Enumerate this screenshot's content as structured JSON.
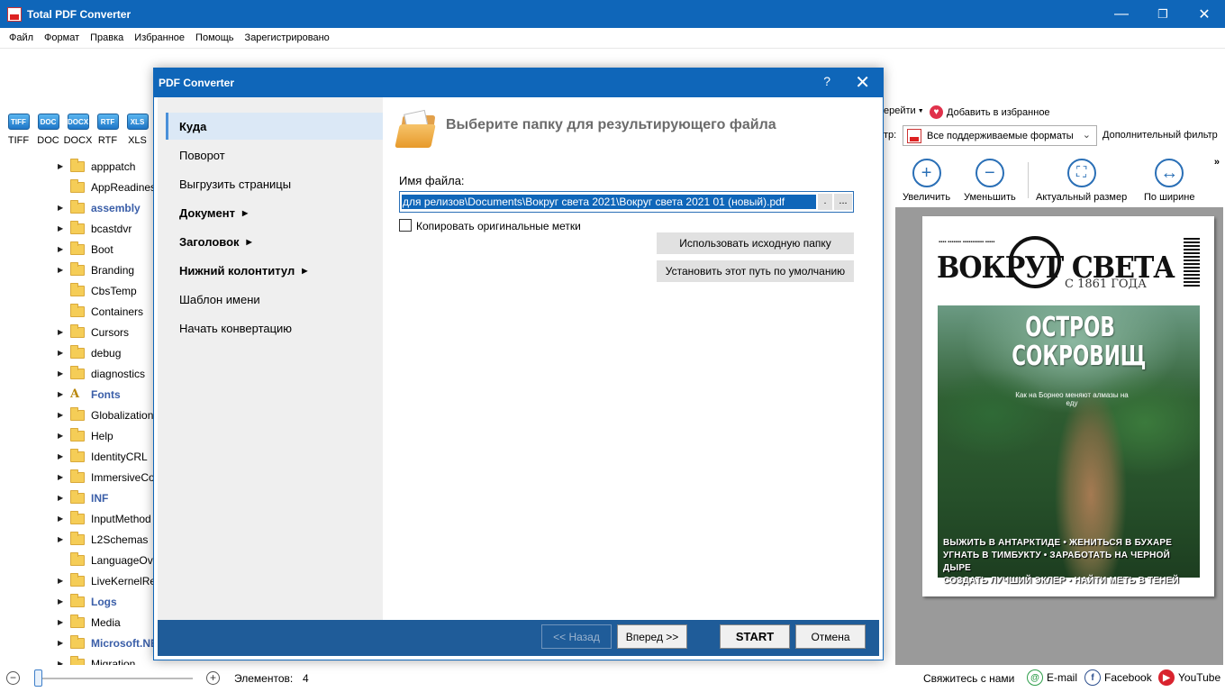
{
  "app": {
    "title": "Total PDF Converter"
  },
  "menu": [
    "Файл",
    "Формат",
    "Правка",
    "Избранное",
    "Помощь",
    "Зарегистрировано"
  ],
  "formats": [
    {
      "icon": "TIFF",
      "label": "TIFF"
    },
    {
      "icon": "DOC",
      "label": "DOC"
    },
    {
      "icon": "DOCX",
      "label": "DOCX"
    },
    {
      "icon": "RTF",
      "label": "RTF"
    },
    {
      "icon": "XLS",
      "label": "XLS"
    }
  ],
  "tree": [
    {
      "label": "apppatch",
      "arrow": true,
      "bold": false
    },
    {
      "label": "AppReadiness",
      "arrow": false,
      "bold": false
    },
    {
      "label": "assembly",
      "arrow": true,
      "bold": true
    },
    {
      "label": "bcastdvr",
      "arrow": true,
      "bold": false
    },
    {
      "label": "Boot",
      "arrow": true,
      "bold": false
    },
    {
      "label": "Branding",
      "arrow": true,
      "bold": false
    },
    {
      "label": "CbsTemp",
      "arrow": false,
      "bold": false
    },
    {
      "label": "Containers",
      "arrow": false,
      "bold": false
    },
    {
      "label": "Cursors",
      "arrow": true,
      "bold": false
    },
    {
      "label": "debug",
      "arrow": true,
      "bold": false
    },
    {
      "label": "diagnostics",
      "arrow": true,
      "bold": false
    },
    {
      "label": "Fonts",
      "arrow": true,
      "bold": true,
      "font_icon": true
    },
    {
      "label": "Globalization",
      "arrow": true,
      "bold": false
    },
    {
      "label": "Help",
      "arrow": true,
      "bold": false
    },
    {
      "label": "IdentityCRL",
      "arrow": true,
      "bold": false
    },
    {
      "label": "ImmersiveControlPanel",
      "arrow": true,
      "bold": false
    },
    {
      "label": "INF",
      "arrow": true,
      "bold": true
    },
    {
      "label": "InputMethod",
      "arrow": true,
      "bold": false
    },
    {
      "label": "L2Schemas",
      "arrow": true,
      "bold": false
    },
    {
      "label": "LanguageOverlayCache",
      "arrow": false,
      "bold": false
    },
    {
      "label": "LiveKernelReports",
      "arrow": true,
      "bold": false
    },
    {
      "label": "Logs",
      "arrow": true,
      "bold": true
    },
    {
      "label": "Media",
      "arrow": true,
      "bold": false
    },
    {
      "label": "Microsoft.NET",
      "arrow": true,
      "bold": true
    },
    {
      "label": "Migration",
      "arrow": true,
      "bold": false
    }
  ],
  "right_panel": {
    "goto_label": "ерейти",
    "favorite_label": "Добавить в избранное",
    "filter_label": "тр:",
    "filter_value": "Все поддерживаемые форматы",
    "extra_filter": "Дополнительный фильтр",
    "tools": [
      {
        "icon": "zoom-in",
        "glyph": "+",
        "label": "Увеличить"
      },
      {
        "icon": "zoom-out",
        "glyph": "−",
        "label": "Уменьшить"
      },
      {
        "icon": "actual-size",
        "glyph": "⛶",
        "label": "Актуальный размер"
      },
      {
        "icon": "fit-width",
        "glyph": "↔",
        "label": "По ширине"
      }
    ],
    "more": "»"
  },
  "magazine": {
    "title": "ВОКРУГ СВЕТА",
    "since": "С 1861 ГОДА",
    "headline": "ОСТРОВ СОКРОВИЩ",
    "subline": "Как на Борнео меняют алмазы на еду",
    "foot_lines": [
      "ВЫЖИТЬ В АНТАРКТИДЕ • ЖЕНИТЬСЯ В БУХАРЕ",
      "УГНАТЬ В ТИМБУКТУ • ЗАРАБОТАТЬ НА ЧЕРНОЙ ДЫРЕ",
      "СОЗДАТЬ ЛУЧШИЙ ЭКЛЕР • НАЙТИ МЕТЬ В ТЕНЕЙ"
    ]
  },
  "status": {
    "items_label": "Элементов:",
    "items_count": "4",
    "contact": "Свяжитесь с нами",
    "email": "E-mail",
    "facebook": "Facebook",
    "youtube": "YouTube"
  },
  "dialog": {
    "title": "PDF Converter",
    "help": "?",
    "close": "✕",
    "nav": [
      {
        "label": "Куда",
        "bold": true,
        "active": true,
        "submenu": false
      },
      {
        "label": "Поворот",
        "bold": false,
        "active": false,
        "submenu": false
      },
      {
        "label": "Выгрузить страницы",
        "bold": false,
        "active": false,
        "submenu": false
      },
      {
        "label": "Документ",
        "bold": true,
        "active": false,
        "submenu": true
      },
      {
        "label": "Заголовок",
        "bold": true,
        "active": false,
        "submenu": true
      },
      {
        "label": "Нижний колонтитул",
        "bold": true,
        "active": false,
        "submenu": true
      },
      {
        "label": "Шаблон имени",
        "bold": false,
        "active": false,
        "submenu": false
      },
      {
        "label": "Начать конвертацию",
        "bold": false,
        "active": false,
        "submenu": false
      }
    ],
    "heading": "Выберите папку для результирующего файла",
    "file_label": "Имя файла:",
    "file_value": "для релизов\\Documents\\Вокруг света 2021\\Вокруг света 2021 01 (новый).pdf",
    "dot_button": ".",
    "browse_button": "...",
    "copy_tags_label": "Копировать оригинальные метки",
    "copy_tags_checked": false,
    "use_source_button": "Использовать исходную папку",
    "set_default_button": "Установить этот путь по умолчанию",
    "back_button": "<< Назад",
    "next_button": "Вперед >>",
    "start_button": "START",
    "cancel_button": "Отмена"
  }
}
